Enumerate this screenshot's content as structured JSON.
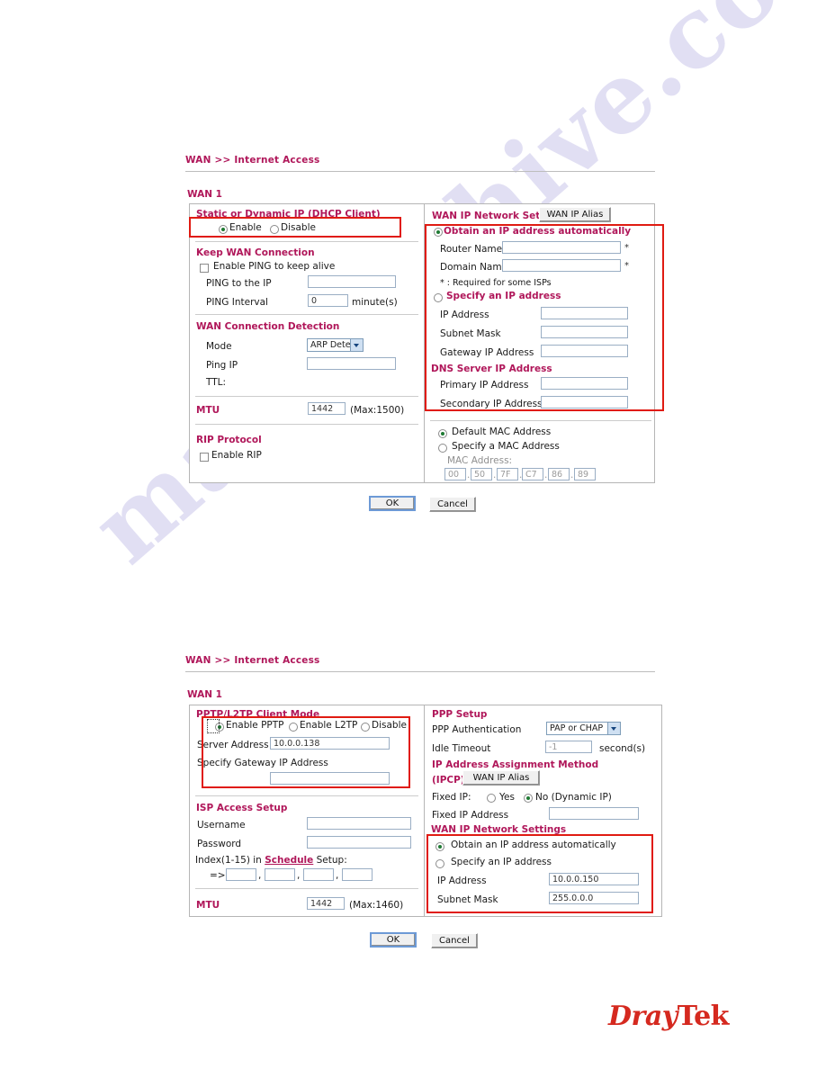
{
  "watermark": "manualshive.com",
  "brand": {
    "dray": "Dray",
    "tek": "Tek"
  },
  "section1": {
    "breadcrumb": "WAN >> Internet Access",
    "wan_label": "WAN 1",
    "left": {
      "title": "Static or Dynamic IP (DHCP Client)",
      "enable_label": "Enable",
      "disable_label": "Disable",
      "keep_wan_title": "Keep WAN Connection",
      "enable_ping_label": "Enable PING to keep alive",
      "ping_ip_label": "PING to the IP",
      "ping_ip_value": "",
      "ping_interval_label": "PING Interval",
      "ping_interval_value": "0",
      "minutes_label": "minute(s)",
      "detect_title": "WAN Connection Detection",
      "mode_label": "Mode",
      "mode_value": "ARP Detect",
      "ping_ip2_label": "Ping IP",
      "ping_ip2_value": "",
      "ttl_label": "TTL:",
      "mtu_label": "MTU",
      "mtu_value": "1442",
      "mtu_max": "(Max:1500)",
      "rip_title": "RIP Protocol",
      "enable_rip_label": "Enable RIP"
    },
    "right": {
      "title": "WAN IP Network Settings",
      "alias_button": "WAN IP Alias",
      "obtain_auto_label": "Obtain an IP address automatically",
      "router_name_label": "Router Name",
      "router_name_value": "",
      "domain_name_label": "Domain Name",
      "domain_name_value": "",
      "required_note": "* : Required for some ISPs",
      "specify_ip_label": "Specify an IP address",
      "ip_address_label": "IP Address",
      "ip_address_value": "",
      "subnet_mask_label": "Subnet Mask",
      "subnet_mask_value": "",
      "gateway_label": "Gateway IP Address",
      "gateway_value": "",
      "dns_title": "DNS Server IP Address",
      "primary_label": "Primary IP Address",
      "primary_value": "",
      "secondary_label": "Secondary IP Address",
      "secondary_value": "",
      "default_mac_label": "Default MAC Address",
      "specify_mac_label": "Specify a MAC Address",
      "mac_address_label": "MAC Address:",
      "mac": [
        "00",
        "50",
        "7F",
        "C7",
        "86",
        "89"
      ]
    },
    "ok_label": "OK",
    "cancel_label": "Cancel"
  },
  "section2": {
    "breadcrumb": "WAN >> Internet Access",
    "wan_label": "WAN 1",
    "left": {
      "title": "PPTP/L2TP Client Mode",
      "enable_pptp_label": "Enable PPTP",
      "enable_l2tp_label": "Enable L2TP",
      "disable_label": "Disable",
      "server_address_label": "Server Address",
      "server_address_value": "10.0.0.138",
      "specify_gateway_label": "Specify Gateway IP Address",
      "specify_gateway_value": "",
      "isp_title": "ISP Access Setup",
      "username_label": "Username",
      "username_value": "",
      "password_label": "Password",
      "password_value": "",
      "index_prefix": "Index(1-15) in",
      "schedule_link": "Schedule",
      "index_suffix": "Setup:",
      "arrow": "=>",
      "schedule_values": [
        "",
        "",
        "",
        ""
      ],
      "mtu_label": "MTU",
      "mtu_value": "1442",
      "mtu_max": "(Max:1460)"
    },
    "right": {
      "ppp_title": "PPP Setup",
      "ppp_auth_label": "PPP Authentication",
      "ppp_auth_value": "PAP or CHAP",
      "idle_timeout_label": "Idle Timeout",
      "idle_timeout_value": "-1",
      "seconds_label": "second(s)",
      "ipcp_title": "IP Address Assignment Method",
      "ipcp_sub": "(IPCP)",
      "alias_button": "WAN IP Alias",
      "fixed_ip_label": "Fixed IP:",
      "yes_label": "Yes",
      "no_label": "No (Dynamic IP)",
      "fixed_ip_address_label": "Fixed IP Address",
      "fixed_ip_address_value": "",
      "wan_net_title": "WAN IP Network Settings",
      "obtain_auto_label": "Obtain an IP address automatically",
      "specify_ip_label": "Specify an IP address",
      "ip_address_label": "IP Address",
      "ip_address_value": "10.0.0.150",
      "subnet_mask_label": "Subnet Mask",
      "subnet_mask_value": "255.0.0.0"
    },
    "ok_label": "OK",
    "cancel_label": "Cancel"
  }
}
